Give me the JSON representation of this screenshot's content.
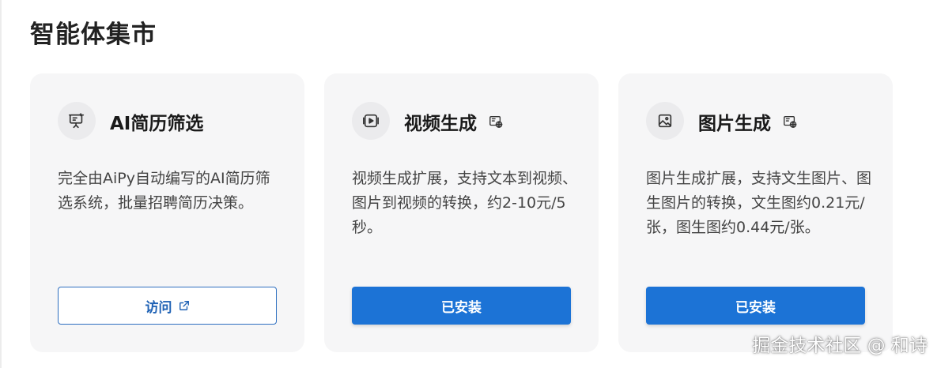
{
  "page": {
    "title": "智能体集市"
  },
  "cards": [
    {
      "icon": "presentation-ai-icon",
      "title": "AI简历筛选",
      "badge": "",
      "description": "完全由AiPy自动编写的AI简历筛选系统，批量招聘简历决策。",
      "button": {
        "label": "访问",
        "style": "outline",
        "icon": "external-link-icon"
      }
    },
    {
      "icon": "video-play-icon",
      "title": "视频生成",
      "badge": "web-app-icon",
      "description": "视频生成扩展，支持文本到视频、图片到视频的转换，约2-10元/5秒。",
      "button": {
        "label": "已安装",
        "style": "primary"
      }
    },
    {
      "icon": "image-icon",
      "title": "图片生成",
      "badge": "web-app-icon",
      "description": "图片生成扩展，支持文生图片、图生图片的转换，文生图约0.21元/张，图生图约0.44元/张。",
      "button": {
        "label": "已安装",
        "style": "primary"
      }
    }
  ],
  "watermark": "掘金技术社区 @ 和诗",
  "colors": {
    "card_bg": "#f6f6f7",
    "primary": "#1c73d6",
    "outline": "#2e6fc0",
    "icon_circle": "#ebebed"
  }
}
